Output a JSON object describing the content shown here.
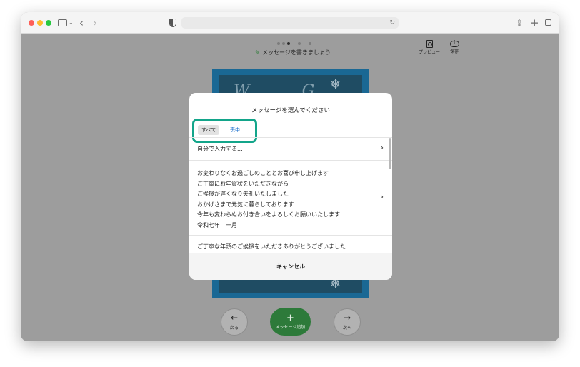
{
  "window": {
    "controls": {
      "close": "close",
      "minimize": "minimize",
      "zoom": "zoom"
    }
  },
  "toolbar": {
    "icons": [
      "sidebar-icon",
      "chevron-down-icon",
      "back-icon",
      "forward-icon",
      "shield-icon",
      "reload-icon",
      "share-icon",
      "plus-icon",
      "tabs-icon"
    ],
    "url": ""
  },
  "editor": {
    "progress": {
      "total_steps": 5,
      "current_step": 3
    },
    "step_title": "メッセージを書きましょう",
    "preview_label": "プレビュー",
    "save_label": "保存",
    "back_label": "戻る",
    "add_message_label": "メッセージ追加",
    "next_label": "次へ",
    "accent_color": "#2d7a3a"
  },
  "modal": {
    "title": "メッセージを選んでください",
    "filters": [
      {
        "label": "すべて",
        "selected": true
      },
      {
        "label": "喪中",
        "selected": false
      }
    ],
    "custom_entry_label": "自分で入力する...",
    "message1": {
      "line1": "お変わりなくお過ごしのこととお喜び申し上げます",
      "line2": "ご丁寧にお年賀状をいただきながら",
      "line3": "ご挨拶が遅くなり失礼いたしました",
      "line4": "おかげさまで元気に暮らしております",
      "line5": "今年も変わらぬお付き合いをよろしくお願いいたします",
      "line6": "令和七年　一月"
    },
    "message2_first_line": "ご丁寧な年頭のご挨拶をいただきありがとうございました",
    "cancel_label": "キャンセル",
    "highlight_color": "#13a58a",
    "link_color": "#1a6fcc"
  }
}
